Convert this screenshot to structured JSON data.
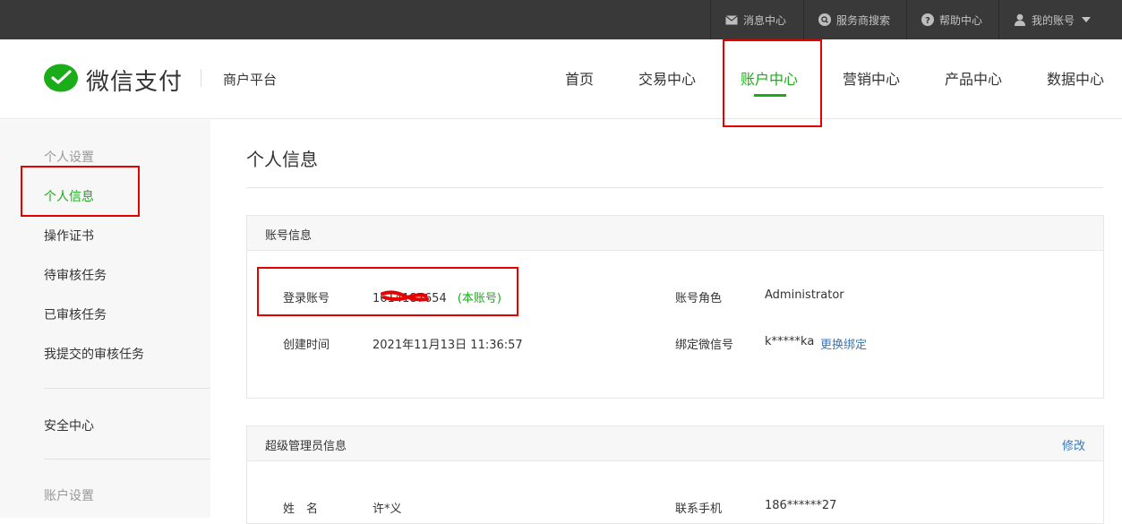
{
  "topbar": {
    "items": [
      {
        "label": "消息中心",
        "icon": "envelope-icon"
      },
      {
        "label": "服务商搜索",
        "icon": "search-circle-icon"
      },
      {
        "label": "帮助中心",
        "icon": "help-icon"
      },
      {
        "label": "我的账号",
        "icon": "user-icon"
      }
    ]
  },
  "header": {
    "logo_text": "微信支付",
    "logo_sub": "商户平台",
    "nav": [
      "首页",
      "交易中心",
      "账户中心",
      "营销中心",
      "产品中心",
      "数据中心"
    ],
    "active_nav": "账户中心"
  },
  "sidebar": {
    "group1": "个人设置",
    "items": [
      "个人信息",
      "操作证书",
      "待审核任务",
      "已审核任务",
      "我提交的审核任务"
    ],
    "security": "安全中心",
    "group2": "账户设置"
  },
  "main": {
    "title": "个人信息",
    "account_panel": {
      "title": "账号信息",
      "login_label": "登录账号",
      "login_value": "1614187654",
      "login_tag": "(本账号)",
      "role_label": "账号角色",
      "role_value": "Administrator",
      "created_label": "创建时间",
      "created_value": "2021年11月13日 11:36:57",
      "wechat_label": "绑定微信号",
      "wechat_value": "k*****ka",
      "wechat_action": "更换绑定"
    },
    "admin_panel": {
      "title": "超级管理员信息",
      "edit": "修改",
      "name_label": "姓　名",
      "name_value": "许*义",
      "phone_label": "联系手机",
      "phone_value": "186******27"
    }
  },
  "colors": {
    "accent": "#1aad19",
    "link": "#3b77b6",
    "annotation": "#e60000",
    "topbar_bg": "#393939"
  }
}
